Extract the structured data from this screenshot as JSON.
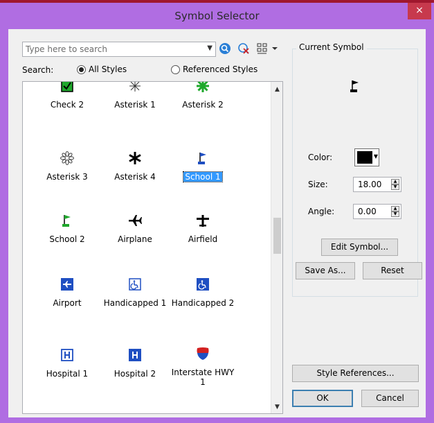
{
  "window": {
    "title": "Symbol Selector",
    "close_glyph": "×"
  },
  "search": {
    "placeholder": "Type here to search",
    "label": "Search:",
    "option_all": "All Styles",
    "option_referenced": "Referenced Styles",
    "selected_option": "All Styles"
  },
  "symbols": [
    {
      "label": "Check 2",
      "icon": "check-box-icon"
    },
    {
      "label": "Asterisk 1",
      "icon": "asterisk-thin-icon"
    },
    {
      "label": "Asterisk 2",
      "icon": "asterisk-green-icon"
    },
    {
      "label": "Asterisk 3",
      "icon": "asterisk-outline-icon"
    },
    {
      "label": "Asterisk 4",
      "icon": "asterisk-bold-icon"
    },
    {
      "label": "School 1",
      "icon": "school-flag-blue-icon",
      "selected": true
    },
    {
      "label": "School 2",
      "icon": "school-flag-green-icon"
    },
    {
      "label": "Airplane",
      "icon": "airplane-icon"
    },
    {
      "label": "Airfield",
      "icon": "airfield-icon"
    },
    {
      "label": "Airport",
      "icon": "airport-icon"
    },
    {
      "label": "Handicapped 1",
      "icon": "handicapped-outline-icon"
    },
    {
      "label": "Handicapped 2",
      "icon": "handicapped-filled-icon"
    },
    {
      "label": "Hospital 1",
      "icon": "hospital-outline-icon"
    },
    {
      "label": "Hospital 2",
      "icon": "hospital-filled-icon"
    },
    {
      "label": "Interstate HWY 1",
      "label_line1": "Interstate HWY",
      "label_line2": "1",
      "icon": "interstate-shield-icon"
    }
  ],
  "current_symbol": {
    "title": "Current Symbol",
    "color_label": "Color:",
    "color_value": "#000000",
    "size_label": "Size:",
    "size_value": "18.00",
    "angle_label": "Angle:",
    "angle_value": "0.00"
  },
  "buttons": {
    "edit_symbol": "Edit Symbol...",
    "save_as": "Save As...",
    "reset": "Reset",
    "style_references": "Style References...",
    "ok": "OK",
    "cancel": "Cancel"
  },
  "colors": {
    "titlebar": "#b06de2",
    "close": "#c7394d",
    "selection": "#3399ff",
    "symbol_blue": "#1f4fc2",
    "symbol_green": "#1fa82c"
  }
}
